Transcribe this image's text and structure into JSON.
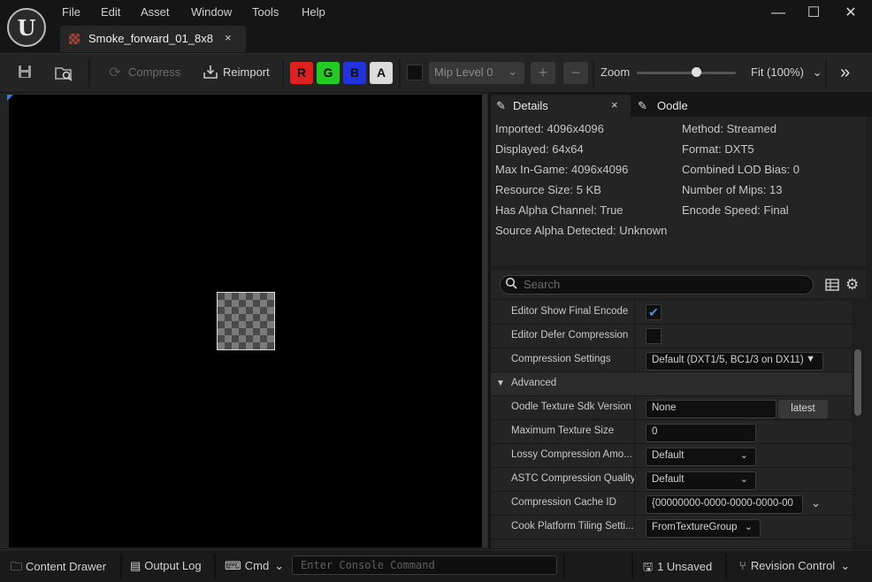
{
  "app": {
    "logo_text": "U"
  },
  "menu": [
    "File",
    "Edit",
    "Asset",
    "Window",
    "Tools",
    "Help"
  ],
  "window_controls": {
    "minimize": "—",
    "maximize": "☐",
    "close": "✕"
  },
  "document_tab": {
    "title": "Smoke_forward_01_8x8",
    "close": "×"
  },
  "toolbar": {
    "compress_label": "Compress",
    "reimport_label": "Reimport",
    "channels": [
      {
        "label": "R",
        "color": "#e02020"
      },
      {
        "label": "G",
        "color": "#22cc22"
      },
      {
        "label": "B",
        "color": "#2233dd"
      },
      {
        "label": "A",
        "color": "#dcdcdc"
      }
    ],
    "mip_level": "Mip Level 0",
    "plus": "+",
    "minus": "−",
    "zoom_label": "Zoom",
    "zoom_value": 0.6,
    "fit_label": "Fit (100%)",
    "more": "»"
  },
  "panel": {
    "tabs": [
      {
        "label": "Details",
        "close": "×"
      },
      {
        "label": "Oodle"
      }
    ],
    "stats_left": [
      "Imported: 4096x4096",
      "Displayed: 64x64",
      "Max In-Game: 4096x4096",
      "Resource Size: 5 KB",
      "Has Alpha Channel: True",
      "Source Alpha Detected: Unknown"
    ],
    "stats_right": [
      "Method: Streamed",
      "Format: DXT5",
      "Combined LOD Bias: 0",
      "Number of Mips: 13",
      "Encode Speed: Final"
    ],
    "search_placeholder": "Search",
    "properties": {
      "editor_show_final_encode": {
        "label": "Editor Show Final Encode",
        "checked": true
      },
      "editor_defer_compression": {
        "label": "Editor Defer Compression",
        "checked": false
      },
      "compression_settings": {
        "label": "Compression Settings",
        "value": "Default (DXT1/5, BC1/3 on DX11)"
      },
      "advanced": {
        "label": "Advanced"
      },
      "oodle_sdk_version": {
        "label": "Oodle Texture Sdk Version",
        "value": "None",
        "button": "latest"
      },
      "max_texture_size": {
        "label": "Maximum Texture Size",
        "value": "0"
      },
      "lossy_compression": {
        "label": "Lossy Compression Amo...",
        "value": "Default"
      },
      "astc_quality": {
        "label": "ASTC Compression Quality",
        "value": "Default"
      },
      "cache_id": {
        "label": "Compression Cache ID",
        "value": "{00000000-0000-0000-0000-00"
      },
      "cook_tiling": {
        "label": "Cook Platform Tiling Setti...",
        "value": "FromTextureGroup"
      }
    }
  },
  "statusbar": {
    "content_drawer": "Content Drawer",
    "output_log": "Output Log",
    "cmd": "Cmd",
    "console_placeholder": "Enter Console Command",
    "unsaved": "1 Unsaved",
    "revision_control": "Revision Control"
  }
}
